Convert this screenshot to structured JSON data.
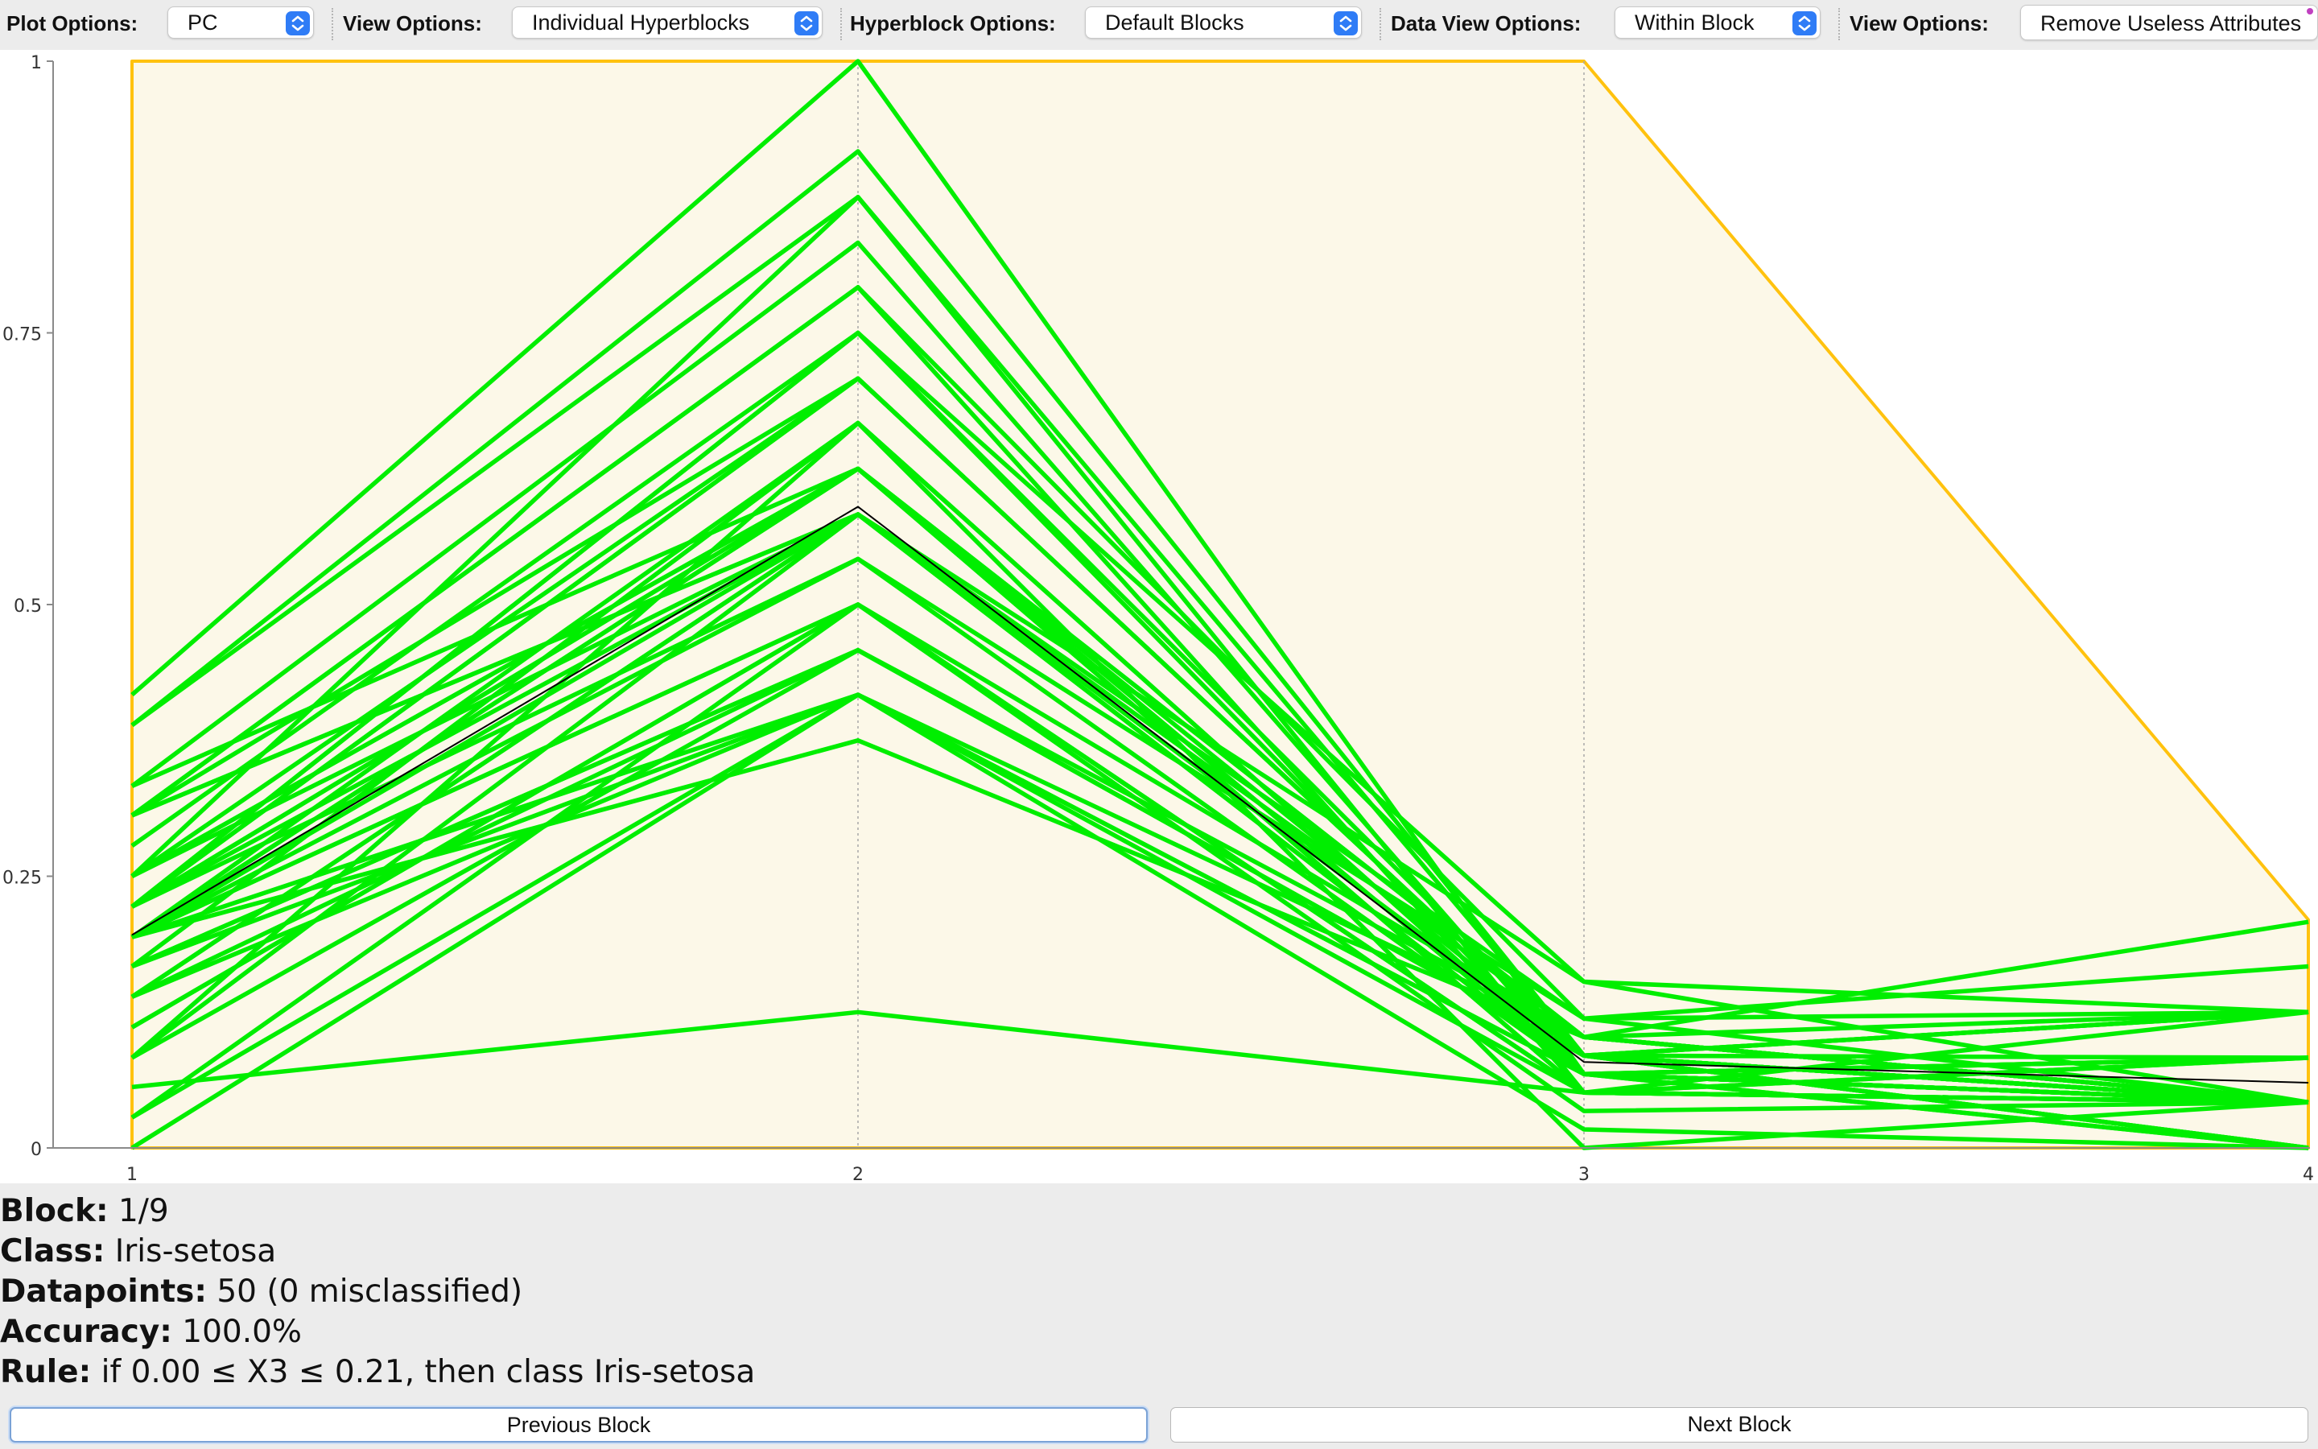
{
  "toolbar": {
    "plot_options_label": "Plot Options:",
    "plot_options_value": "PC",
    "view_options_label": "View Options:",
    "view_options_value": "Individual Hyperblocks",
    "hyperblock_options_label": "Hyperblock Options:",
    "hyperblock_options_value": "Default Blocks",
    "data_view_options_label": "Data View Options:",
    "data_view_options_value": "Within Block",
    "view_options2_label": "View Options:",
    "remove_useless_label": "Remove Useless Attributes",
    "select_arrow_icon": "up-down-chevron-icon"
  },
  "colors": {
    "line": "#00ee00",
    "mean_line": "#000000",
    "block_border": "#ffc20e",
    "block_fill": "#fcf8e8",
    "accent": "#2f7cf6"
  },
  "chart_data": {
    "type": "line",
    "chart_kind": "parallel-coordinates",
    "x": [
      "1",
      "2",
      "3",
      "4"
    ],
    "ylim": [
      0,
      1
    ],
    "yticks": [
      "0",
      "0.25",
      "0.5",
      "0.75",
      "1"
    ],
    "grid": "vertical dotted lines at each attribute axis",
    "hyperblock": {
      "upper": [
        1,
        1,
        1,
        0.21
      ],
      "lower": [
        0,
        0,
        0,
        0
      ]
    },
    "mean": [
      0.196,
      0.59,
      0.079,
      0.06
    ],
    "series": [
      {
        "values": [
          0.417,
          1.0,
          0.068,
          0.042
        ]
      },
      {
        "values": [
          0.389,
          0.917,
          0.085,
          0.125
        ]
      },
      {
        "values": [
          0.389,
          0.875,
          0.051,
          0.042
        ]
      },
      {
        "values": [
          0.333,
          0.833,
          0.068,
          0.083
        ]
      },
      {
        "values": [
          0.306,
          0.792,
          0.119,
          0.125
        ]
      },
      {
        "values": [
          0.306,
          0.792,
          0.051,
          0.125
        ]
      },
      {
        "values": [
          0.278,
          0.75,
          0.068,
          0.042
        ]
      },
      {
        "values": [
          0.25,
          0.708,
          0.085,
          0.042
        ]
      },
      {
        "values": [
          0.222,
          0.708,
          0.085,
          0.042
        ]
      },
      {
        "values": [
          0.222,
          0.75,
          0.085,
          0.083
        ]
      },
      {
        "values": [
          0.333,
          0.625,
          0.051,
          0.042
        ]
      },
      {
        "values": [
          0.306,
          0.583,
          0.085,
          0.125
        ]
      },
      {
        "values": [
          0.25,
          0.625,
          0.085,
          0.042
        ]
      },
      {
        "values": [
          0.222,
          0.625,
          0.068,
          0.042
        ]
      },
      {
        "values": [
          0.194,
          0.667,
          0.068,
          0.042
        ]
      },
      {
        "values": [
          0.194,
          0.625,
          0.102,
          0.208
        ]
      },
      {
        "values": [
          0.167,
          0.667,
          0.068,
          0.0
        ]
      },
      {
        "values": [
          0.25,
          0.583,
          0.068,
          0.042
        ]
      },
      {
        "values": [
          0.194,
          0.583,
          0.085,
          0.042
        ]
      },
      {
        "values": [
          0.222,
          0.583,
          0.085,
          0.042
        ]
      },
      {
        "values": [
          0.194,
          0.542,
          0.068,
          0.042
        ]
      },
      {
        "values": [
          0.139,
          0.583,
          0.102,
          0.042
        ]
      },
      {
        "values": [
          0.222,
          0.542,
          0.119,
          0.167
        ]
      },
      {
        "values": [
          0.167,
          0.458,
          0.085,
          0.0
        ]
      },
      {
        "values": [
          0.194,
          0.5,
          0.034,
          0.042
        ]
      },
      {
        "values": [
          0.139,
          0.458,
          0.102,
          0.042
        ]
      },
      {
        "values": [
          0.194,
          0.5,
          0.051,
          0.042
        ]
      },
      {
        "values": [
          0.167,
          0.417,
          0.068,
          0.042
        ]
      },
      {
        "values": [
          0.139,
          0.417,
          0.068,
          0.0
        ]
      },
      {
        "values": [
          0.111,
          0.5,
          0.102,
          0.042
        ]
      },
      {
        "values": [
          0.111,
          0.5,
          0.051,
          0.042
        ]
      },
      {
        "values": [
          0.083,
          0.458,
          0.085,
          0.042
        ]
      },
      {
        "values": [
          0.083,
          0.583,
          0.068,
          0.083
        ]
      },
      {
        "values": [
          0.028,
          0.417,
          0.051,
          0.042
        ]
      },
      {
        "values": [
          0.028,
          0.5,
          0.051,
          0.042
        ]
      },
      {
        "values": [
          0.0,
          0.417,
          0.017,
          0.0
        ]
      },
      {
        "values": [
          0.056,
          0.125,
          0.051,
          0.083
        ]
      },
      {
        "values": [
          0.139,
          0.583,
          0.153,
          0.042
        ]
      },
      {
        "values": [
          0.25,
          0.875,
          0.085,
          0.0
        ]
      },
      {
        "values": [
          0.222,
          0.75,
          0.153,
          0.125
        ]
      },
      {
        "values": [
          0.194,
          0.625,
          0.051,
          0.083
        ]
      },
      {
        "values": [
          0.306,
          0.708,
          0.085,
          0.042
        ]
      },
      {
        "values": [
          0.083,
          0.667,
          0.0,
          0.042
        ]
      },
      {
        "values": [
          0.222,
          0.625,
          0.068,
          0.083
        ]
      },
      {
        "values": [
          0.194,
          0.375,
          0.102,
          0.125
        ]
      },
      {
        "values": [
          0.25,
          0.625,
          0.102,
          0.042
        ]
      },
      {
        "values": [
          0.194,
          0.417,
          0.102,
          0.042
        ]
      },
      {
        "values": [
          0.306,
          0.583,
          0.119,
          0.042
        ]
      },
      {
        "values": [
          0.167,
          0.458,
          0.085,
          0.0
        ]
      },
      {
        "values": [
          0.222,
          0.708,
          0.085,
          0.125
        ]
      }
    ]
  },
  "info": {
    "block_label": "Block:",
    "block_value": "1/9",
    "class_label": "Class:",
    "class_value": "Iris-setosa",
    "datapoints_label": "Datapoints:",
    "datapoints_value": "50 (0 misclassified)",
    "accuracy_label": "Accuracy:",
    "accuracy_value": "100.0%",
    "rule_label": "Rule:",
    "rule_value": "if 0.00 ≤ X3 ≤ 0.21, then class Iris-setosa"
  },
  "nav": {
    "previous_label": "Previous Block",
    "next_label": "Next Block"
  }
}
